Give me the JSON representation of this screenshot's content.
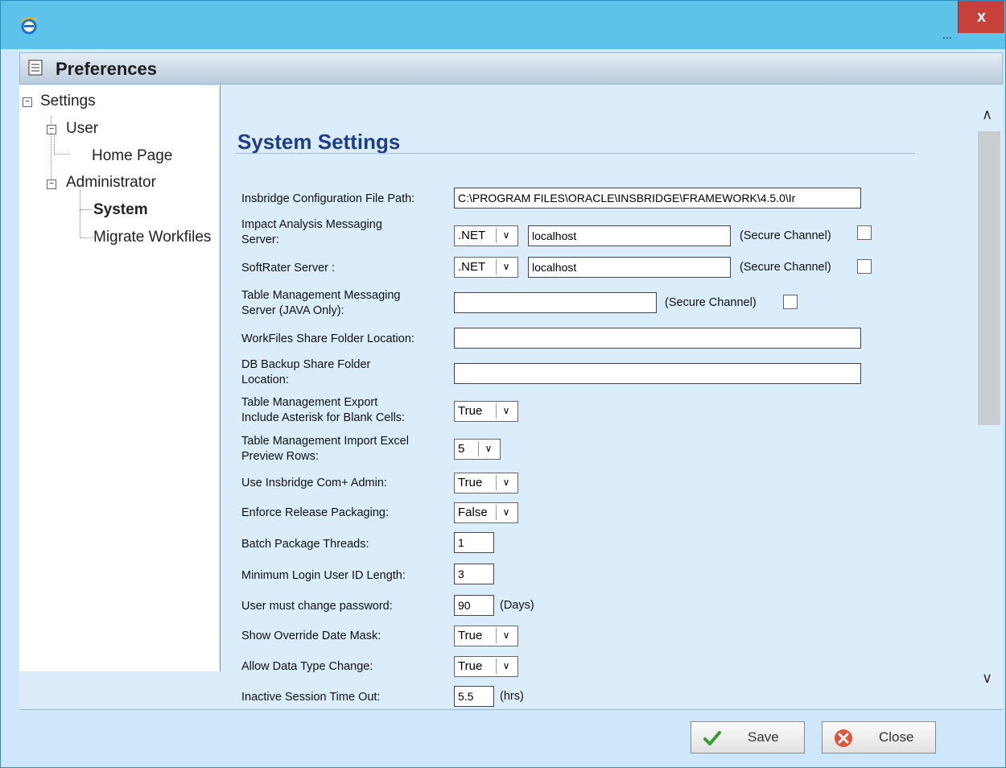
{
  "window": {
    "app_icon": "ie-icon",
    "more_label": "...",
    "close_label": "x"
  },
  "header": {
    "title": "Preferences",
    "icon": "checklist-icon"
  },
  "tree": {
    "settings": "Settings",
    "user": "User",
    "home_page": "Home Page",
    "administrator": "Administrator",
    "system": "System",
    "migrate": "Migrate Workfiles",
    "expander": "−"
  },
  "section": {
    "title": "System Settings"
  },
  "fields": {
    "config_path": {
      "label": "Insbridge Configuration File Path:",
      "value": "C:\\PROGRAM FILES\\ORACLE\\INSBRIDGE\\FRAMEWORK\\4.5.0\\Ir"
    },
    "impact": {
      "label1": "Impact Analysis Messaging",
      "label2": "Server:",
      "type": ".NET",
      "server": "localhost",
      "secure": "(Secure Channel)"
    },
    "softrater": {
      "label": "SoftRater Server :",
      "type": ".NET",
      "server": "localhost",
      "secure": "(Secure Channel)"
    },
    "table_mgmt": {
      "label1": "Table Management Messaging",
      "label2": "Server (JAVA Only):",
      "server": "",
      "secure": "(Secure Channel)"
    },
    "workfiles": {
      "label": "WorkFiles Share Folder Location:",
      "value": ""
    },
    "dbbackup": {
      "label1": "DB Backup Share Folder",
      "label2": "Location:",
      "value": ""
    },
    "export_asterisk": {
      "label1": "Table Management Export",
      "label2": "Include Asterisk for Blank Cells:",
      "value": "True"
    },
    "import_preview": {
      "label1": "Table Management Import Excel",
      "label2": "Preview Rows:",
      "value": "5"
    },
    "complus": {
      "label": "Use Insbridge Com+ Admin:",
      "value": "True"
    },
    "release_pkg": {
      "label": "Enforce Release Packaging:",
      "value": "False"
    },
    "batch_threads": {
      "label": "Batch Package Threads:",
      "value": "1"
    },
    "min_login": {
      "label": "Minimum Login User ID Length:",
      "value": "3"
    },
    "pwd_change": {
      "label": "User must change password:",
      "value": "90",
      "unit": "(Days)"
    },
    "override_mask": {
      "label": "Show Override Date Mask:",
      "value": "True"
    },
    "data_type": {
      "label": "Allow Data Type Change:",
      "value": "True"
    },
    "session_timeout": {
      "label": "Inactive Session Time Out:",
      "value": "5.5",
      "unit": "(hrs)"
    }
  },
  "dropdown_arrow": "∨",
  "scroll": {
    "up": "∧",
    "down": "∨"
  },
  "footer": {
    "save_label": "Save",
    "close_label": "Close"
  },
  "colors": {
    "title": "#1f3d8a",
    "titlebar": "#5ec3ea",
    "close": "#c8403a"
  }
}
